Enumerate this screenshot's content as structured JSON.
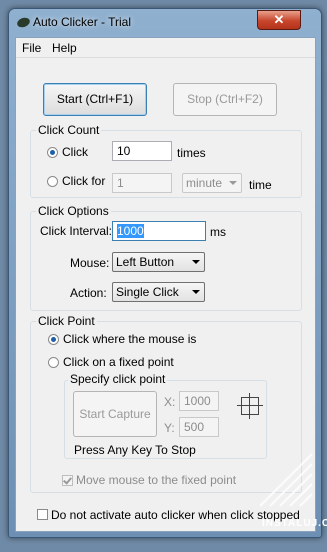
{
  "window": {
    "title": "Auto Clicker - Trial",
    "close_glyph": "✕"
  },
  "menu": {
    "file": "File",
    "help": "Help"
  },
  "buttons": {
    "start": "Start (Ctrl+F1)",
    "stop": "Stop (Ctrl+F2)"
  },
  "click_count": {
    "label": "Click Count",
    "click_label": "Click",
    "click_value": "10",
    "times": "times",
    "click_for_label": "Click for",
    "click_for_value": "1",
    "unit_selected": "minute",
    "time": "time"
  },
  "click_options": {
    "label": "Click Options",
    "interval_label": "Click Interval:",
    "interval_value": "1000",
    "ms": "ms",
    "mouse_label": "Mouse:",
    "mouse_selected": "Left Button",
    "action_label": "Action:",
    "action_selected": "Single Click"
  },
  "click_point": {
    "label": "Click Point",
    "where_mouse": "Click where the mouse is",
    "fixed_point": "Click on a fixed point",
    "specify_label": "Specify click point",
    "capture_button": "Start Capture",
    "x_label": "X:",
    "x_value": "1000",
    "y_label": "Y:",
    "y_value": "500",
    "press_key": "Press Any Key To Stop",
    "move_mouse": "Move mouse to the fixed point"
  },
  "footer": {
    "do_not_activate": "Do not activate auto clicker when click stopped"
  },
  "watermark": {
    "text": "INSTALUJ.CZ"
  },
  "icons": [
    "app-icon",
    "close-icon",
    "crosshair-icon",
    "chevron-down-icon"
  ],
  "colors": {
    "desktop": "#6f8aa6",
    "titlebar": "#8fb0cf",
    "close": "#c8452c",
    "accent": "#1f5fa8"
  }
}
